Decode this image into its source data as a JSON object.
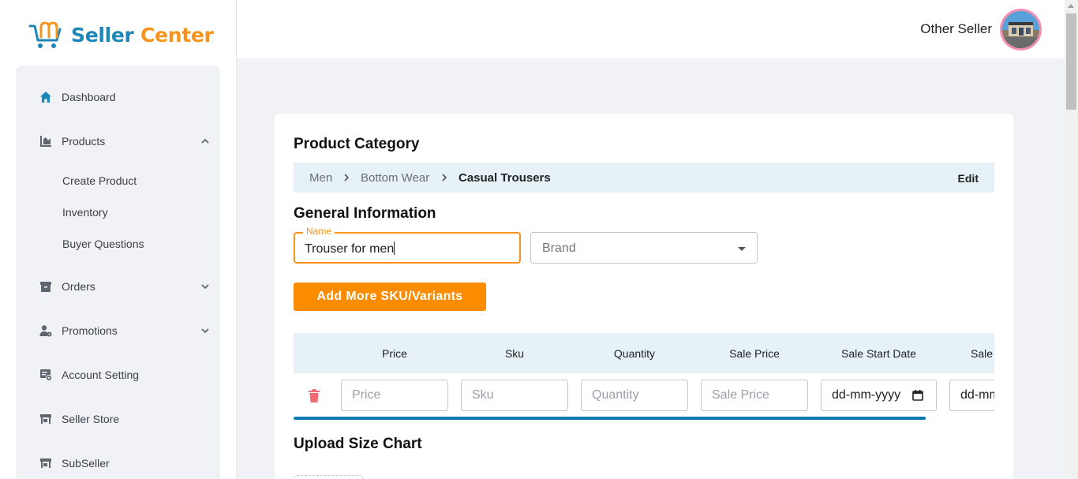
{
  "brand": {
    "part1": "Seller",
    "part2": "Center",
    "color_primary": "#1f86b8",
    "color_accent": "#f7941d"
  },
  "header": {
    "user_name": "Other Seller"
  },
  "sidebar": {
    "items": [
      {
        "label": "Dashboard",
        "icon": "home-icon"
      },
      {
        "label": "Products",
        "icon": "products-icon",
        "expanded": true
      },
      {
        "label": "Orders",
        "icon": "orders-icon",
        "expanded": false
      },
      {
        "label": "Promotions",
        "icon": "promotions-icon",
        "expanded": false
      },
      {
        "label": "Account Setting",
        "icon": "account-setting-icon"
      },
      {
        "label": "Seller Store",
        "icon": "store-icon"
      },
      {
        "label": "SubSeller",
        "icon": "store-icon"
      }
    ],
    "products_sub": [
      "Create Product",
      "Inventory",
      "Buyer Questions"
    ]
  },
  "product_category": {
    "title": "Product Category",
    "breadcrumb": [
      "Men",
      "Bottom Wear",
      "Casual Trousers"
    ],
    "edit_label": "Edit"
  },
  "general_info": {
    "title": "General Information",
    "name_label": "Name",
    "name_value": "Trouser for men",
    "brand_placeholder": "Brand",
    "add_button": "Add More SKU/Variants"
  },
  "variants_table": {
    "headers": [
      "Price",
      "Sku",
      "Quantity",
      "Sale Price",
      "Sale Start Date",
      "Sale"
    ],
    "row_placeholders": [
      "Price",
      "Sku",
      "Quantity",
      "Sale Price"
    ],
    "date_placeholder": "dd-mm-yyyy",
    "date_placeholder_partial": "dd-mm"
  },
  "upload": {
    "title": "Upload Size Chart"
  },
  "colors": {
    "accent_orange": "#fb8c00",
    "focus_orange": "#f7941d",
    "light_blue_bg": "#e6f1f8",
    "progress_blue": "#0f7bb5",
    "delete_red": "#f06b73"
  }
}
